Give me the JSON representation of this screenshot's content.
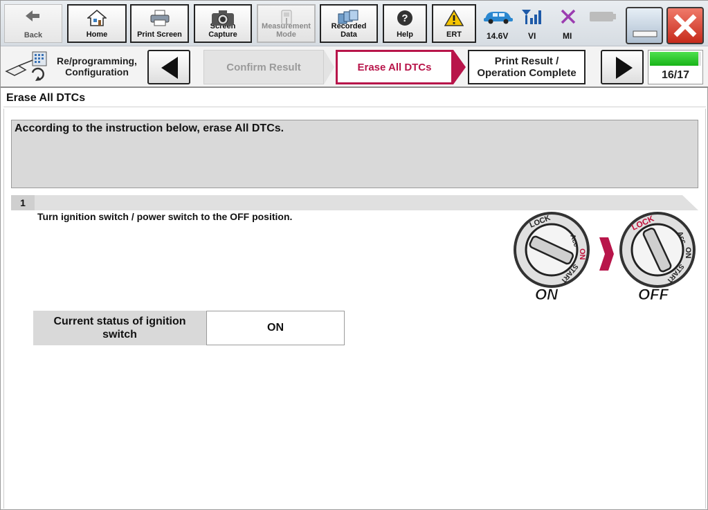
{
  "toolbar": {
    "back_label": "Back",
    "home_label": "Home",
    "print_screen_label": "Print Screen",
    "screen_capture_label": "Screen Capture",
    "measurement_mode_label": "Measurement Mode",
    "recorded_data_label": "Recorded Data",
    "help_label": "Help",
    "ert_label": "ERT",
    "battery_voltage": "14.6V",
    "vi_label": "VI",
    "mi_label": "MI"
  },
  "navbar": {
    "mode_label": "Re/programming, Configuration",
    "steps": [
      {
        "label": "Confirm Result",
        "state": "done"
      },
      {
        "label": "Erase All DTCs",
        "state": "active"
      },
      {
        "label": "Print Result / Operation Complete",
        "state": "next"
      }
    ],
    "progress_text": "16/17",
    "progress_fraction": 0.94
  },
  "page": {
    "section_title": "Erase All DTCs",
    "instruction": "According to the instruction below, erase All DTCs.",
    "step_number": "1",
    "step_text": "Turn ignition switch / power switch to the OFF position.",
    "diagram": {
      "lock_text": "LOCK",
      "acc_text": "Acc",
      "on_text": "ON",
      "start_text": "START",
      "caption_from": "ON",
      "caption_to": "OFF"
    },
    "status_label": "Current status of ignition switch",
    "status_value": "ON"
  },
  "colors": {
    "accent": "#b8154a",
    "progress_green": "#1ec81e",
    "close_red": "#d33a2a"
  }
}
